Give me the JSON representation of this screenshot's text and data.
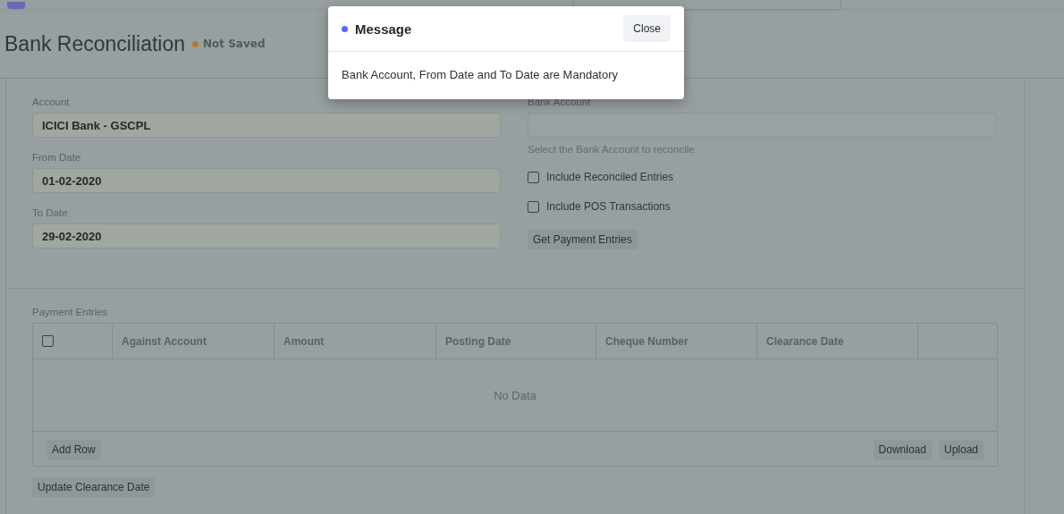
{
  "page": {
    "title": "Bank Reconciliation",
    "status": "Not Saved"
  },
  "form": {
    "left_fields": [
      {
        "label": "Account",
        "value": "ICICI Bank - GSCPL"
      },
      {
        "label": "From Date",
        "value": "01-02-2020"
      },
      {
        "label": "To Date",
        "value": "29-02-2020"
      }
    ],
    "bank_account": {
      "label": "Bank Account",
      "help": "Select the Bank Account to reconcile."
    },
    "checks": [
      {
        "label": "Include Reconciled Entries",
        "checked": false
      },
      {
        "label": "Include POS Transactions",
        "checked": false
      }
    ],
    "action_button": "Get Payment Entries"
  },
  "table": {
    "label": "Payment Entries",
    "select_all_checked": false,
    "columns": [
      "Against Account",
      "Amount",
      "Posting Date",
      "Cheque Number",
      "Clearance Date"
    ],
    "empty_text": "No Data",
    "left_buttons": [
      "Add Row"
    ],
    "right_buttons": [
      "Download",
      "Upload"
    ]
  },
  "footer_button": "Update Clearance Date",
  "dialog": {
    "title": "Message",
    "message": "Bank Account, From Date and To Date are Mandatory",
    "close": "Close"
  }
}
